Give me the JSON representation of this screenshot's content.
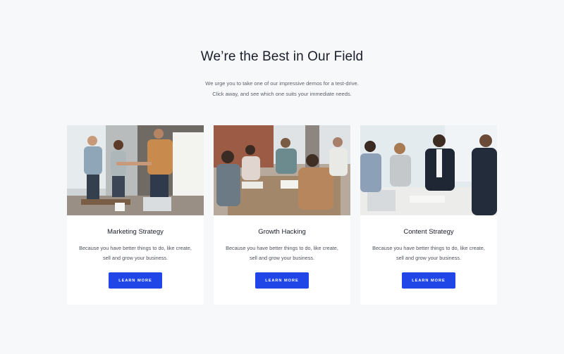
{
  "section": {
    "title": "We’re the Best in Our Field",
    "subtitle_line1": "We urge you to take one of our impressive demos for a test-drive.",
    "subtitle_line2": "Click away, and see which one suits your immediate needs."
  },
  "cards": [
    {
      "title": "Marketing Strategy",
      "text_line1": "Because you have better things to do, like create,",
      "text_line2": "sell and grow your business.",
      "button": "LEARN MORE",
      "image": "team-handshake-photo"
    },
    {
      "title": "Growth Hacking",
      "text_line1": "Because you have better things to do, like create,",
      "text_line2": "sell and grow your business.",
      "button": "LEARN MORE",
      "image": "team-meeting-table-photo"
    },
    {
      "title": "Content Strategy",
      "text_line1": "Because you have better things to do, like create,",
      "text_line2": "sell and grow your business.",
      "button": "LEARN MORE",
      "image": "business-meeting-photo"
    }
  ],
  "colors": {
    "background": "#f7f8fa",
    "card": "#ffffff",
    "button": "#2146e8",
    "heading": "#1b1e2b"
  }
}
